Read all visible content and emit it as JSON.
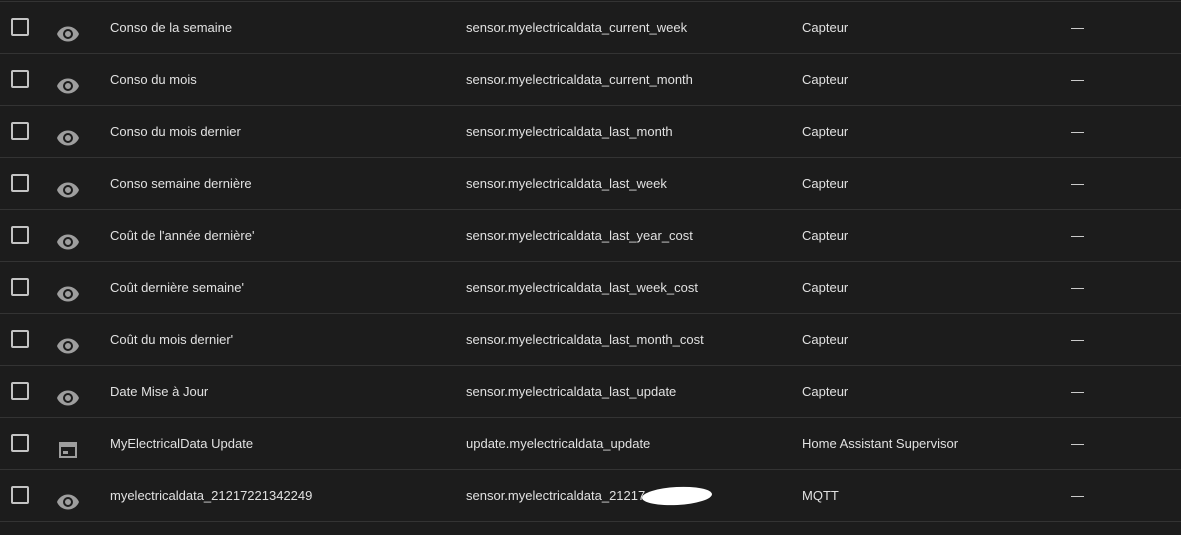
{
  "rows": [
    {
      "name": "Conso de la semaine",
      "entity_id": "sensor.myelectricaldata_current_week",
      "integration": "Capteur",
      "area": "—",
      "icon": "eye-icon"
    },
    {
      "name": "Conso du mois",
      "entity_id": "sensor.myelectricaldata_current_month",
      "integration": "Capteur",
      "area": "—",
      "icon": "eye-icon"
    },
    {
      "name": "Conso du mois dernier",
      "entity_id": "sensor.myelectricaldata_last_month",
      "integration": "Capteur",
      "area": "—",
      "icon": "eye-icon"
    },
    {
      "name": "Conso semaine dernière",
      "entity_id": "sensor.myelectricaldata_last_week",
      "integration": "Capteur",
      "area": "—",
      "icon": "eye-icon"
    },
    {
      "name": "Coût de l'année dernière'",
      "entity_id": "sensor.myelectricaldata_last_year_cost",
      "integration": "Capteur",
      "area": "—",
      "icon": "eye-icon"
    },
    {
      "name": "Coût dernière semaine'",
      "entity_id": "sensor.myelectricaldata_last_week_cost",
      "integration": "Capteur",
      "area": "—",
      "icon": "eye-icon"
    },
    {
      "name": "Coût du mois dernier'",
      "entity_id": "sensor.myelectricaldata_last_month_cost",
      "integration": "Capteur",
      "area": "—",
      "icon": "eye-icon"
    },
    {
      "name": "Date Mise à Jour",
      "entity_id": "sensor.myelectricaldata_last_update",
      "integration": "Capteur",
      "area": "—",
      "icon": "eye-icon"
    },
    {
      "name": "MyElectricalData Update",
      "entity_id": "update.myelectricaldata_update",
      "integration": "Home Assistant Supervisor",
      "area": "—",
      "icon": "package-icon"
    },
    {
      "name": "myelectricaldata_21217221342249",
      "entity_id": "sensor.myelectricaldata_21217",
      "integration": "MQTT",
      "area": "—",
      "icon": "eye-icon",
      "redacted": true
    }
  ],
  "colors": {
    "background": "#1c1c1c",
    "divider": "#333333",
    "text": "#e1e1e1",
    "icon": "#9e9e9e",
    "checkbox_border": "#c4c4c4"
  }
}
